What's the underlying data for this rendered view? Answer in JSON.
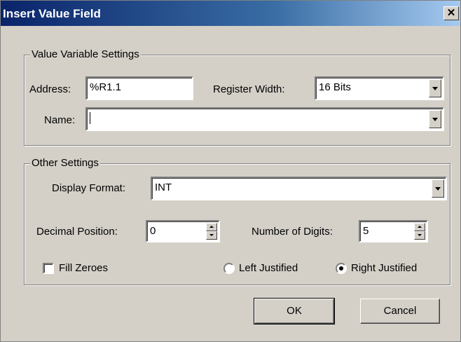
{
  "window": {
    "title": "Insert Value Field",
    "close_label": "✕"
  },
  "value_group": {
    "legend": "Value Variable Settings",
    "address_label": "Address:",
    "address_value": "%R1.1",
    "register_width_label": "Register Width:",
    "register_width_value": "16 Bits",
    "name_label": "Name:",
    "name_value": ""
  },
  "other_group": {
    "legend": "Other Settings",
    "display_format_label": "Display Format:",
    "display_format_value": "INT",
    "decimal_position_label": "Decimal Position:",
    "decimal_position_value": "0",
    "number_of_digits_label": "Number of Digits:",
    "number_of_digits_value": "5",
    "fill_zeroes_label": "Fill Zeroes",
    "fill_zeroes_checked": false,
    "left_justified_label": "Left Justified",
    "right_justified_label": "Right Justified",
    "justification_selected": "right"
  },
  "buttons": {
    "ok": "OK",
    "cancel": "Cancel"
  }
}
